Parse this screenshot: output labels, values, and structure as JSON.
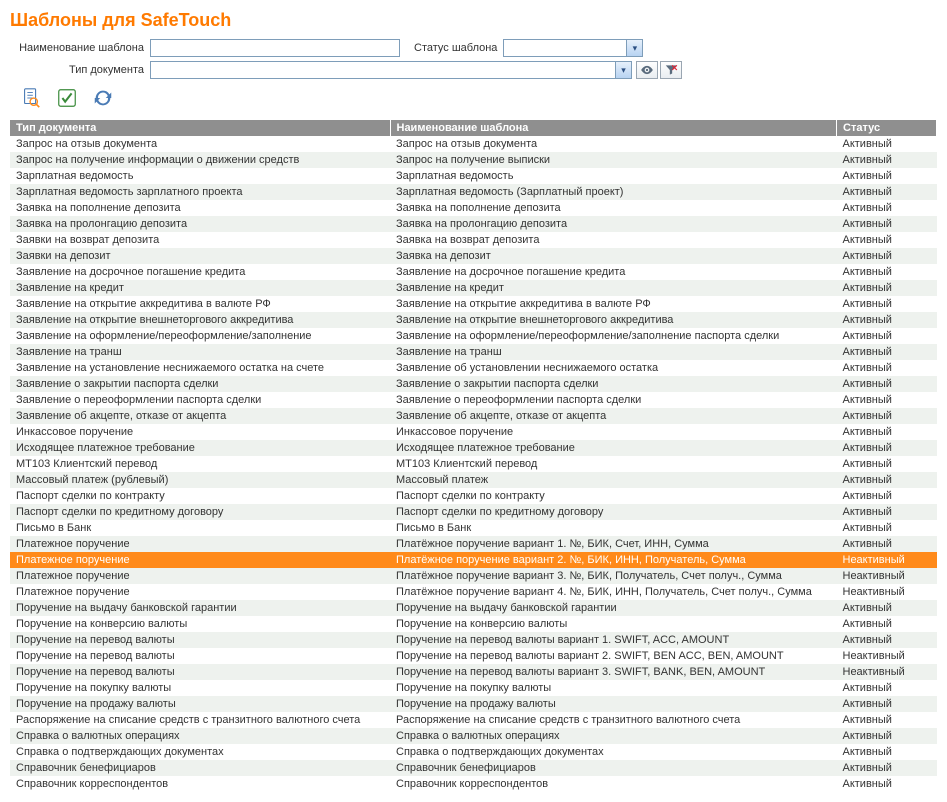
{
  "title": "Шаблоны для SafeTouch",
  "filters": {
    "name_label": "Наименование шаблона",
    "name_value": "",
    "status_label": "Статус шаблона",
    "status_value": "",
    "doctype_label": "Тип документа",
    "doctype_value": ""
  },
  "columns": {
    "c1": "Тип документа",
    "c2": "Наименование шаблона",
    "c3": "Статус"
  },
  "rows": [
    {
      "t": "Запрос на отзыв документа",
      "n": "Запрос на отзыв документа",
      "s": "Активный"
    },
    {
      "t": "Запрос на получение информации о движении средств",
      "n": "Запрос на получение выписки",
      "s": "Активный"
    },
    {
      "t": "Зарплатная ведомость",
      "n": "Зарплатная ведомость",
      "s": "Активный"
    },
    {
      "t": "Зарплатная ведомость зарплатного проекта",
      "n": "Зарплатная ведомость (Зарплатный проект)",
      "s": "Активный"
    },
    {
      "t": "Заявка на пополнение депозита",
      "n": "Заявка на пополнение депозита",
      "s": "Активный"
    },
    {
      "t": "Заявка на пролонгацию депозита",
      "n": "Заявка на пролонгацию депозита",
      "s": "Активный"
    },
    {
      "t": "Заявки на возврат депозита",
      "n": "Заявка на возврат депозита",
      "s": "Активный"
    },
    {
      "t": "Заявки на депозит",
      "n": "Заявка на депозит",
      "s": "Активный"
    },
    {
      "t": "Заявление на досрочное погашение кредита",
      "n": "Заявление на досрочное погашение кредита",
      "s": "Активный"
    },
    {
      "t": "Заявление на кредит",
      "n": "Заявление на кредит",
      "s": "Активный"
    },
    {
      "t": "Заявление на открытие аккредитива в валюте РФ",
      "n": "Заявление на открытие аккредитива в валюте РФ",
      "s": "Активный"
    },
    {
      "t": "Заявление на открытие внешнеторгового аккредитива",
      "n": "Заявление на открытие внешнеторгового аккредитива",
      "s": "Активный"
    },
    {
      "t": "Заявление на оформление/переоформление/заполнение",
      "n": "Заявление на оформление/переоформление/заполнение паспорта сделки",
      "s": "Активный"
    },
    {
      "t": "Заявление на транш",
      "n": "Заявление на транш",
      "s": "Активный"
    },
    {
      "t": "Заявление на установление неснижаемого остатка на счете",
      "n": "Заявление об установлении неснижаемого остатка",
      "s": "Активный"
    },
    {
      "t": "Заявление о закрытии паспорта сделки",
      "n": "Заявление о закрытии паспорта сделки",
      "s": "Активный"
    },
    {
      "t": "Заявление о переоформлении паспорта сделки",
      "n": "Заявление о переоформлении паспорта сделки",
      "s": "Активный"
    },
    {
      "t": "Заявление об акцепте, отказе от акцепта",
      "n": "Заявление об акцепте, отказе от акцепта",
      "s": "Активный"
    },
    {
      "t": "Инкассовое поручение",
      "n": "Инкассовое поручение",
      "s": "Активный"
    },
    {
      "t": "Исходящее платежное требование",
      "n": "Исходящее платежное требование",
      "s": "Активный"
    },
    {
      "t": "MT103 Клиентский перевод",
      "n": "MT103 Клиентский перевод",
      "s": "Активный"
    },
    {
      "t": "Массовый платеж (рублевый)",
      "n": "Массовый платеж",
      "s": "Активный"
    },
    {
      "t": "Паспорт сделки по контракту",
      "n": "Паспорт сделки по контракту",
      "s": "Активный"
    },
    {
      "t": "Паспорт сделки по кредитному договору",
      "n": "Паспорт сделки по кредитному договору",
      "s": "Активный"
    },
    {
      "t": "Письмо в Банк",
      "n": "Письмо в Банк",
      "s": "Активный"
    },
    {
      "t": "Платежное поручение",
      "n": "Платёжное поручение вариант 1. №, БИК, Счет, ИНН, Сумма",
      "s": "Активный"
    },
    {
      "t": "Платежное поручение",
      "n": "Платёжное поручение вариант 2. №, БИК, ИНН, Получатель, Сумма",
      "s": "Неактивный",
      "sel": true
    },
    {
      "t": "Платежное поручение",
      "n": "Платёжное поручение вариант 3. №, БИК, Получатель, Счет получ., Сумма",
      "s": "Неактивный"
    },
    {
      "t": "Платежное поручение",
      "n": "Платёжное поручение вариант 4. №, БИК, ИНН, Получатель, Счет получ., Сумма",
      "s": "Неактивный"
    },
    {
      "t": "Поручение на выдачу банковской гарантии",
      "n": "Поручение на выдачу банковской гарантии",
      "s": "Активный"
    },
    {
      "t": "Поручение на конверсию валюты",
      "n": "Поручение на конверсию валюты",
      "s": "Активный"
    },
    {
      "t": "Поручение на перевод валюты",
      "n": "Поручение на перевод валюты вариант 1. SWIFT, ACC, AMOUNT",
      "s": "Активный"
    },
    {
      "t": "Поручение на перевод валюты",
      "n": "Поручение на перевод валюты вариант 2. SWIFT, BEN ACC, BEN, AMOUNT",
      "s": "Неактивный"
    },
    {
      "t": "Поручение на перевод валюты",
      "n": "Поручение на перевод валюты вариант 3. SWIFT, BANK, BEN, AMOUNT",
      "s": "Неактивный"
    },
    {
      "t": "Поручение на покупку валюты",
      "n": "Поручение на покупку валюты",
      "s": "Активный"
    },
    {
      "t": "Поручение на продажу валюты",
      "n": "Поручение на продажу валюты",
      "s": "Активный"
    },
    {
      "t": "Распоряжение на списание средств с транзитного валютного счета",
      "n": "Распоряжение на списание средств с транзитного валютного счета",
      "s": "Активный"
    },
    {
      "t": "Справка о валютных операциях",
      "n": "Справка о валютных операциях",
      "s": "Активный"
    },
    {
      "t": "Справка о подтверждающих документах",
      "n": "Справка о подтверждающих документах",
      "s": "Активный"
    },
    {
      "t": "Справочник бенефициаров",
      "n": "Справочник бенефициаров",
      "s": "Активный"
    },
    {
      "t": "Справочник корреспондентов",
      "n": "Справочник корреспондентов",
      "s": "Активный"
    }
  ]
}
